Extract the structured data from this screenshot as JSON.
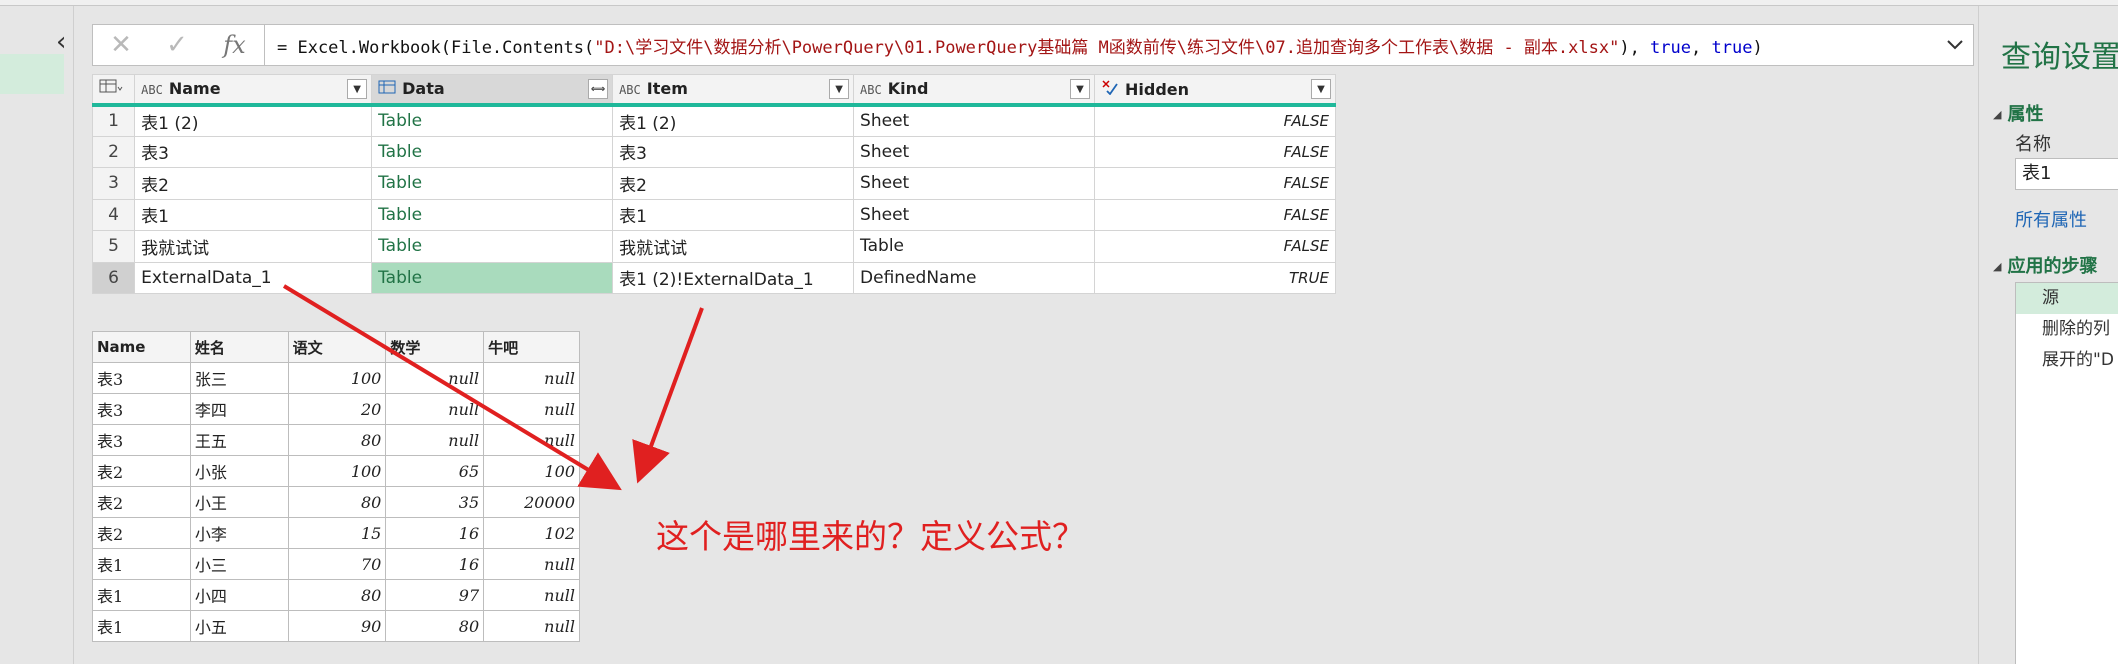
{
  "formula": {
    "prefix": "= Excel.Workbook(File.Contents(",
    "path": "\"D:\\学习文件\\数据分析\\PowerQuery\\01.PowerQuery基础篇 M函数前传\\练习文件\\07.追加查询多个工作表\\数据 - 副本.xlsx\"",
    "mid": "), ",
    "arg1": "true",
    "sep": ", ",
    "arg2": "true",
    "suffix": ")",
    "cancel_icon": "✕",
    "confirm_icon": "✓",
    "fx_label": "fx",
    "expand_icon": "⌄"
  },
  "preview": {
    "columns": [
      {
        "name": "Name",
        "type": "ABC"
      },
      {
        "name": "Data",
        "type": "table"
      },
      {
        "name": "Item",
        "type": "ABC"
      },
      {
        "name": "Kind",
        "type": "ABC"
      },
      {
        "name": "Hidden",
        "type": "check"
      }
    ],
    "rows": [
      {
        "num": "1",
        "name": "表1 (2)",
        "data": "Table",
        "item": "表1 (2)",
        "kind": "Sheet",
        "hidden": "FALSE"
      },
      {
        "num": "2",
        "name": "表3",
        "data": "Table",
        "item": "表3",
        "kind": "Sheet",
        "hidden": "FALSE"
      },
      {
        "num": "3",
        "name": "表2",
        "data": "Table",
        "item": "表2",
        "kind": "Sheet",
        "hidden": "FALSE"
      },
      {
        "num": "4",
        "name": "表1",
        "data": "Table",
        "item": "表1",
        "kind": "Sheet",
        "hidden": "FALSE"
      },
      {
        "num": "5",
        "name": "我就试试",
        "data": "Table",
        "item": "我就试试",
        "kind": "Table",
        "hidden": "FALSE"
      },
      {
        "num": "6",
        "name": "ExternalData_1",
        "data": "Table",
        "item": "表1 (2)!ExternalData_1",
        "kind": "DefinedName",
        "hidden": "TRUE"
      }
    ]
  },
  "data_table": {
    "headers": [
      "Name",
      "姓名",
      "语文",
      "数学",
      "牛吧"
    ],
    "rows": [
      [
        "表3",
        "张三",
        "100",
        "null",
        "null"
      ],
      [
        "表3",
        "李四",
        "20",
        "null",
        "null"
      ],
      [
        "表3",
        "王五",
        "80",
        "null",
        "null"
      ],
      [
        "表2",
        "小张",
        "100",
        "65",
        "100"
      ],
      [
        "表2",
        "小王",
        "80",
        "35",
        "20000"
      ],
      [
        "表2",
        "小李",
        "15",
        "16",
        "102"
      ],
      [
        "表1",
        "小三",
        "70",
        "16",
        "null"
      ],
      [
        "表1",
        "小四",
        "80",
        "97",
        "null"
      ],
      [
        "表1",
        "小五",
        "90",
        "80",
        "null"
      ]
    ]
  },
  "annotation": {
    "text": "这个是哪里来的？定义公式？",
    "color": "#e02020"
  },
  "query_settings": {
    "title": "查询设置",
    "properties_heading": "属性",
    "name_label": "名称",
    "name_value": "表1",
    "all_properties_link": "所有属性",
    "steps_heading": "应用的步骤",
    "steps": [
      "源",
      "删除的列",
      "展开的\"D"
    ]
  },
  "colors": {
    "accent_green": "#217346",
    "header_underline": "#1fb89a",
    "selected_cell": "#a9dbbd",
    "link_blue": "#1f66b5"
  }
}
